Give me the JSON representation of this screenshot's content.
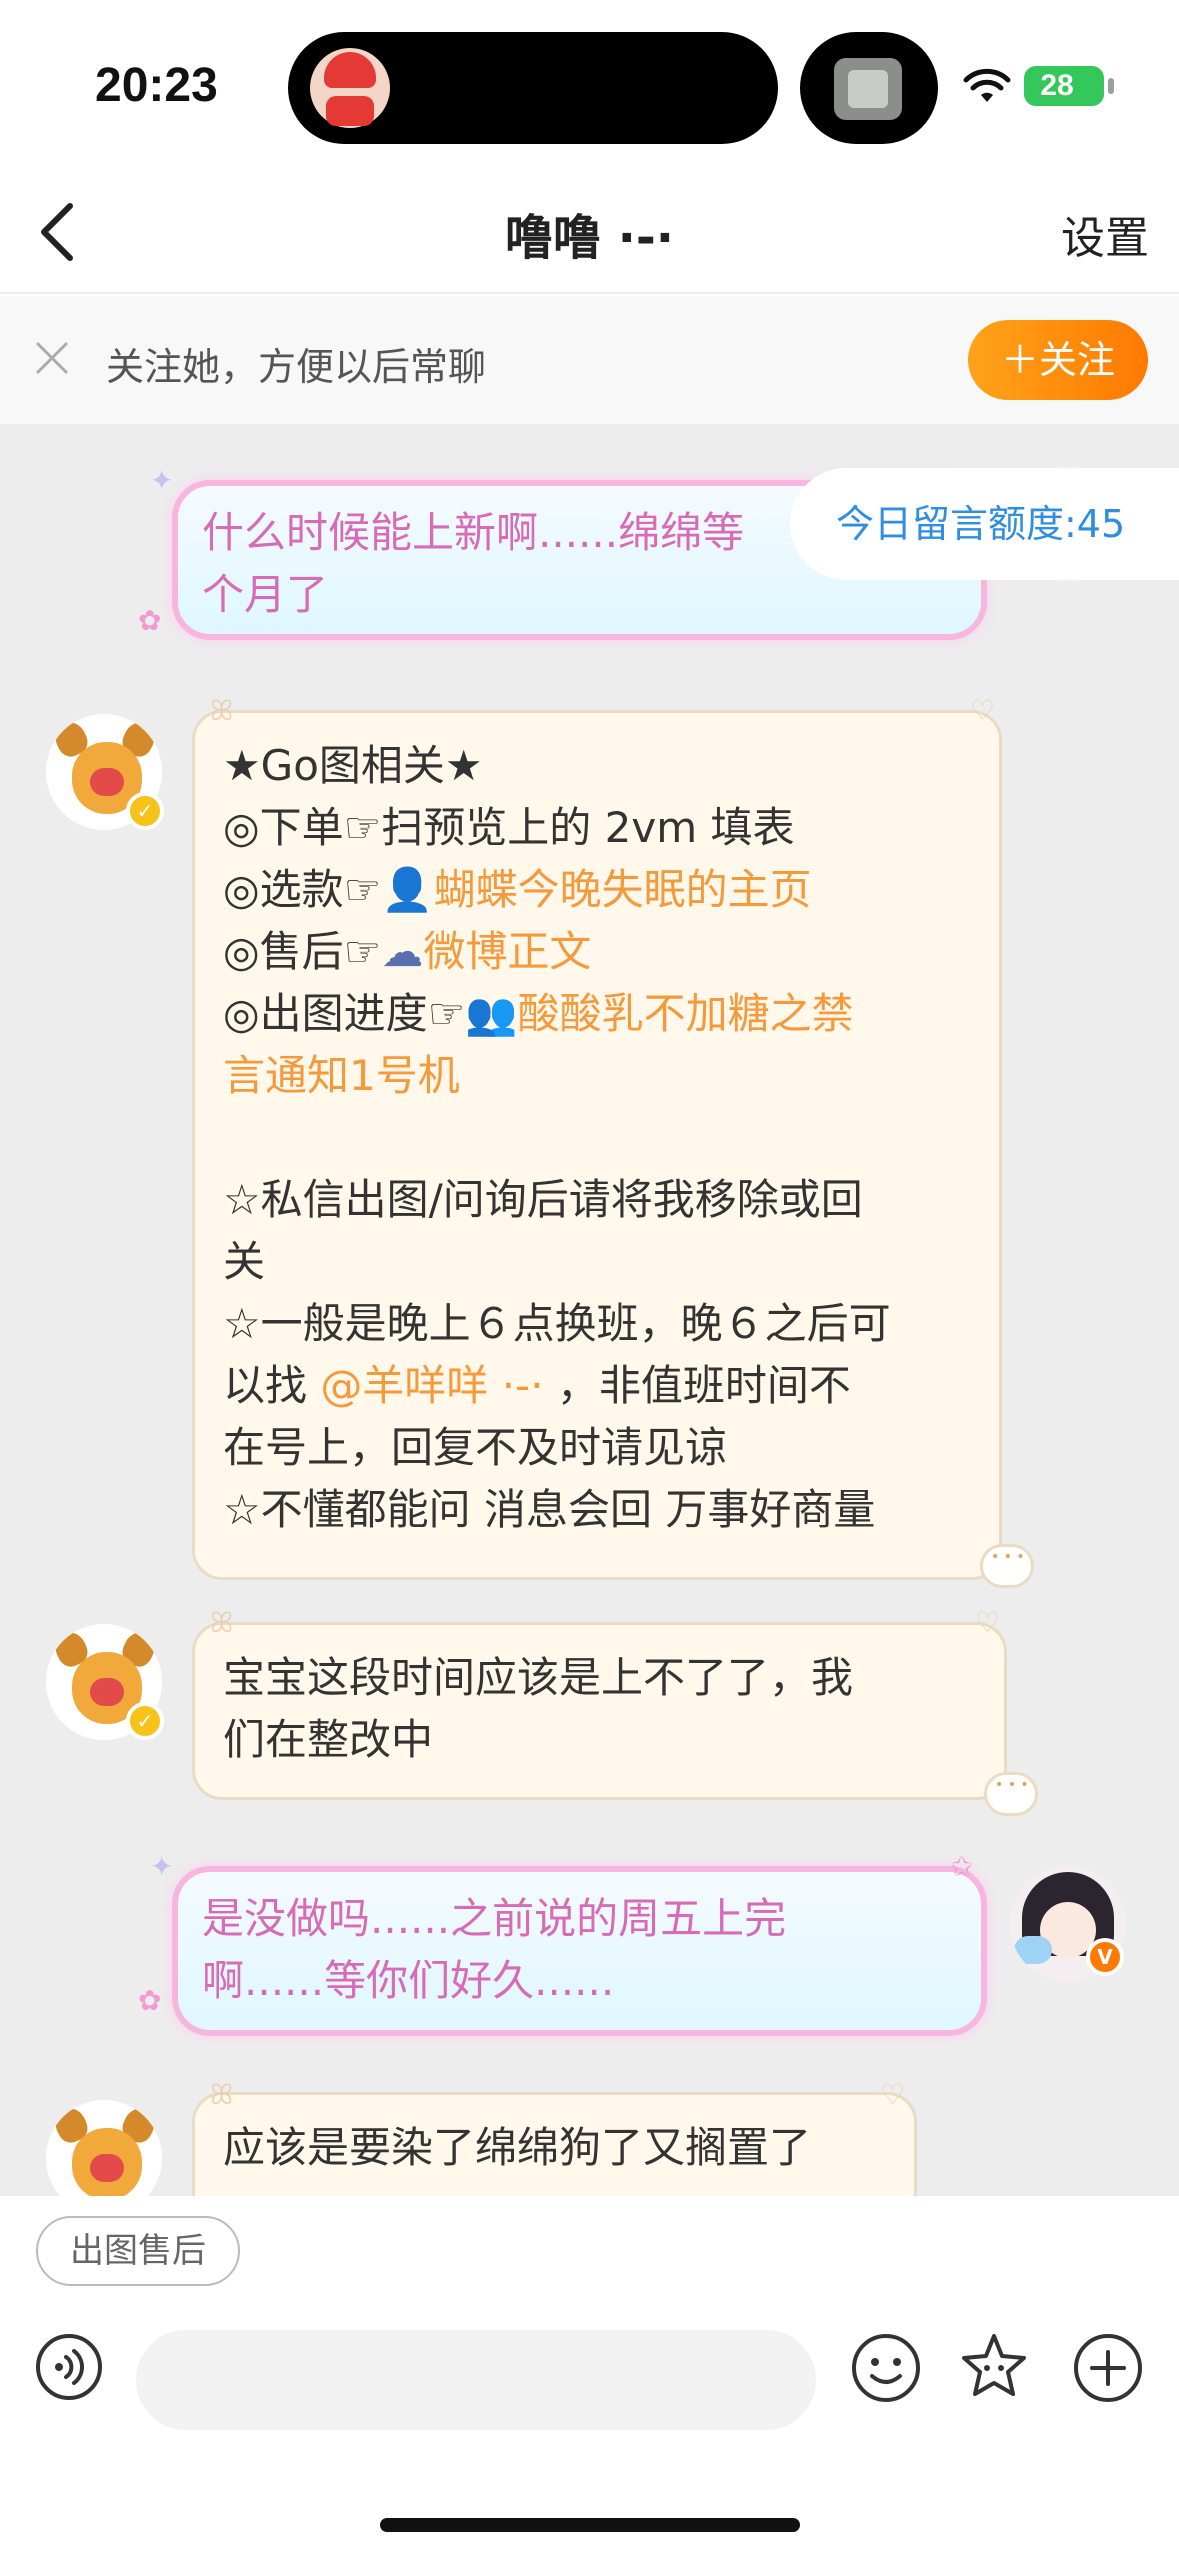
{
  "status_bar": {
    "time": "20:23",
    "battery": "28"
  },
  "nav": {
    "title": "噜噜 ·-·",
    "settings_label": "设置"
  },
  "follow_banner": {
    "text": "关注她，方便以后常聊",
    "button_label": "＋关注"
  },
  "quota": {
    "text": "今日留言额度:45"
  },
  "messages": [
    {
      "sender": "me",
      "lines": [
        "什么时候能上新啊......绵绵等",
        "个月了"
      ]
    },
    {
      "sender": "shop",
      "lines": [
        "★Go图相关★",
        "◎下单☞扫预览上的 2vm 填表",
        "◎选款☞",
        "蝴蝶今晚失眠的主页",
        "◎售后☞",
        "微博正文",
        "◎出图进度☞",
        "酸酸乳不加糖之禁",
        "言通知1号机",
        "",
        "☆私信出图/问询后请将我移除或回",
        "关",
        "☆一般是晚上６点换班，晚６之后可",
        "以找 ",
        "@羊咩咩 ·-·",
        " ，非值班时间不",
        "在号上，回复不及时请见谅",
        "☆不懂都能问 消息会回 万事好商量"
      ]
    },
    {
      "sender": "shop",
      "lines": [
        "宝宝这段时间应该是上不了了，我",
        "们在整改中"
      ]
    },
    {
      "sender": "me",
      "lines": [
        "是没做吗......之前说的周五上完",
        "啊......等你们好久......"
      ]
    },
    {
      "sender": "shop",
      "lines": [
        "应该是要染了绵绵狗了又搁置了"
      ]
    }
  ],
  "quick_reply": {
    "label": "出图售后"
  },
  "icons": {
    "back": "chevron-left-icon",
    "close": "close-icon",
    "voice": "voice-icon",
    "emoji": "emoji-icon",
    "sticker": "star-sticker-icon",
    "plus": "plus-icon"
  },
  "colors": {
    "accent_orange": "#ff8a00",
    "link_orange": "#f59a3c",
    "pink_text": "#d86bb8",
    "quota_blue": "#2f8ee0"
  }
}
